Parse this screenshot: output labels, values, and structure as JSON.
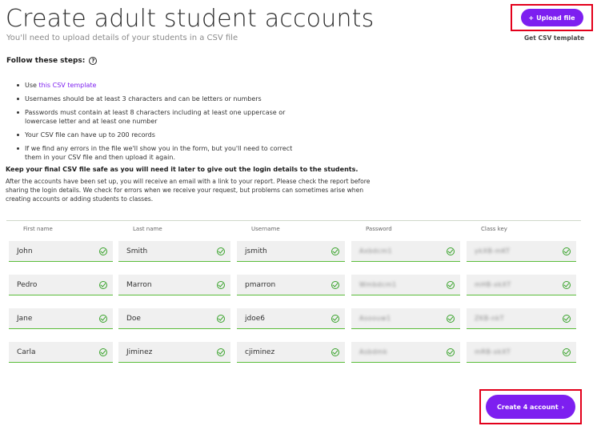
{
  "header": {
    "title": "Create adult student accounts",
    "subtitle": "You'll need to upload details of your students in a CSV file",
    "upload_icon": "+",
    "upload_label": "Upload file",
    "get_csv_label": "Get CSV template"
  },
  "steps": {
    "heading": "Follow these steps:",
    "help_icon": "?",
    "item1_prefix": "Use ",
    "item1_link": "this CSV template",
    "item2": "Usernames should be at least 3 characters and can be letters or numbers",
    "item3": "Passwords must contain at least 8 characters including at least one uppercase or lowercase letter and at least one number",
    "item4": "Your CSV file can have up to 200 records",
    "item5": "If we find any errors in the file we'll show you in the form, but you'll need to correct them in your CSV file and then upload it again."
  },
  "notes": {
    "keep_safe": "Keep your final CSV file safe as you will need it later to give out the login details to the students.",
    "after_setup": "After the accounts have been set up, you will receive an email with a link to your report. Please check the report before sharing the login details. We check for errors when we receive your request, but problems can sometimes arise when creating accounts or adding students to classes."
  },
  "table": {
    "columns": [
      "First name",
      "Last name",
      "Username",
      "Password",
      "Class key"
    ],
    "rows": [
      [
        "John",
        "Smith",
        "jsmith",
        "Axbdcm1",
        "ykXB-mKT"
      ],
      [
        "Pedro",
        "Marron",
        "pmarron",
        "Wmbdcm1",
        "mHB-xkXT"
      ],
      [
        "Jane",
        "Doe",
        "jdoe6",
        "Asoouw1",
        "ZKB-nkT"
      ],
      [
        "Carla",
        "Jiminez",
        "cjiminez",
        "Asbdmk",
        "mRB-xkXT"
      ]
    ]
  },
  "footer": {
    "create_label": "Create 4 account",
    "create_icon": "›"
  },
  "colors": {
    "accent": "#7d1ff0",
    "valid": "#3aa32c",
    "highlight_box": "#e3001b"
  }
}
